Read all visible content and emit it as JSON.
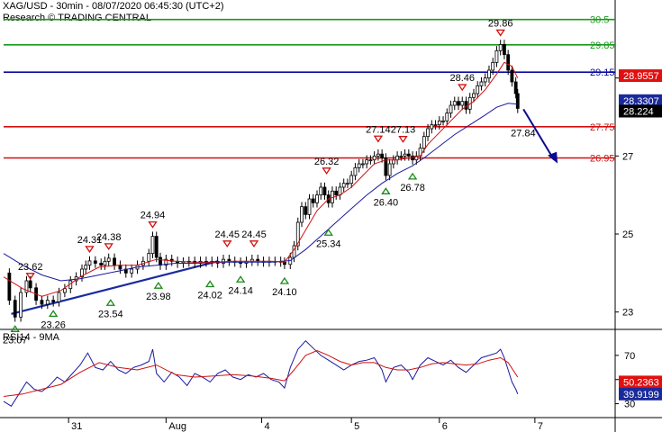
{
  "header": {
    "line1": "XAG/USD - 30min - 08/07/2020 06:45:30 (UTC+2)",
    "line2": "Research © TRADING CENTRAL"
  },
  "colors": {
    "candle": "#000000",
    "ma_fast": "#d01010",
    "ma_slow": "#1a1aa0",
    "trendline": "#1a2aa0",
    "level_green": "#1a9a1a",
    "level_blue": "#0a0aa0",
    "level_red": "#d01010",
    "arrow": "#0a0a90",
    "up_marker": "#1a8a1a",
    "down_marker": "#d01010",
    "rsi_line": "#1a1aa0",
    "rsi_ma": "#d01010"
  },
  "chart_data": {
    "type": "line",
    "title": "XAG/USD - 30min",
    "ylim": [
      22.6,
      31.0
    ],
    "price_ticks": [
      "23",
      "25",
      "27",
      "29"
    ],
    "x_tick_labels": [
      "31",
      "Aug",
      "4",
      "5",
      "6",
      "7"
    ],
    "levels": [
      {
        "value": 30.5,
        "label": "30.5",
        "color": "level_green"
      },
      {
        "value": 29.85,
        "label": "29.85",
        "color": "level_green"
      },
      {
        "value": 29.15,
        "label": "29.15",
        "color": "level_blue"
      },
      {
        "value": 27.75,
        "label": "27.75",
        "color": "level_red"
      },
      {
        "value": 26.95,
        "label": "26.95",
        "color": "level_red"
      }
    ],
    "price_tags": [
      {
        "label": "28.9557",
        "value": 29.06,
        "bg": "#e01010"
      },
      {
        "label": "28.3307",
        "value": 28.42,
        "bg": "#1a2a9a"
      },
      {
        "label": "28.224",
        "value": 28.15,
        "bg": "#000000"
      }
    ],
    "up_markers": [
      {
        "label": "23.07",
        "t": 6,
        "value": 22.87
      },
      {
        "label": "23.26",
        "t": 26,
        "value": 23.26
      },
      {
        "label": "23.54",
        "t": 56,
        "value": 23.54
      },
      {
        "label": "23.98",
        "t": 81,
        "value": 23.98
      },
      {
        "label": "24.02",
        "t": 108,
        "value": 24.02
      },
      {
        "label": "24.14",
        "t": 124,
        "value": 24.14
      },
      {
        "label": "24.10",
        "t": 147,
        "value": 24.1
      },
      {
        "label": "25.34",
        "t": 170,
        "value": 25.34
      },
      {
        "label": "26.40",
        "t": 200,
        "value": 26.4
      },
      {
        "label": "26.78",
        "t": 214,
        "value": 26.78
      }
    ],
    "down_markers": [
      {
        "label": "23.62",
        "t": 14,
        "value": 23.62
      },
      {
        "label": "24.31",
        "t": 45,
        "value": 24.31
      },
      {
        "label": "24.38",
        "t": 55,
        "value": 24.38
      },
      {
        "label": "24.94",
        "t": 78,
        "value": 24.94
      },
      {
        "label": "24.45",
        "t": 117,
        "value": 24.45
      },
      {
        "label": "24.45",
        "t": 131,
        "value": 24.45
      },
      {
        "label": "26.32",
        "t": 169,
        "value": 26.32
      },
      {
        "label": "27.14",
        "t": 196,
        "value": 27.14
      },
      {
        "label": "27.13",
        "t": 209,
        "value": 27.13
      },
      {
        "label": "28.46",
        "t": 240,
        "value": 28.46
      },
      {
        "label": "29.86",
        "t": 260,
        "value": 29.86
      }
    ],
    "price_path": [
      [
        0,
        24.0
      ],
      [
        3,
        23.3
      ],
      [
        6,
        22.87
      ],
      [
        9,
        23.5
      ],
      [
        12,
        23.8
      ],
      [
        14,
        23.62
      ],
      [
        17,
        23.3
      ],
      [
        20,
        23.2
      ],
      [
        23,
        23.3
      ],
      [
        26,
        23.26
      ],
      [
        29,
        23.5
      ],
      [
        32,
        23.6
      ],
      [
        35,
        23.8
      ],
      [
        38,
        23.9
      ],
      [
        41,
        24.1
      ],
      [
        43,
        24.2
      ],
      [
        45,
        24.31
      ],
      [
        48,
        24.25
      ],
      [
        51,
        24.2
      ],
      [
        53,
        24.3
      ],
      [
        55,
        24.38
      ],
      [
        58,
        24.2
      ],
      [
        61,
        24.1
      ],
      [
        64,
        24.0
      ],
      [
        67,
        24.1
      ],
      [
        70,
        24.2
      ],
      [
        73,
        24.3
      ],
      [
        76,
        24.5
      ],
      [
        78,
        24.94
      ],
      [
        80,
        24.4
      ],
      [
        82,
        24.2
      ],
      [
        85,
        24.35
      ],
      [
        88,
        24.3
      ],
      [
        91,
        24.25
      ],
      [
        94,
        24.28
      ],
      [
        97,
        24.3
      ],
      [
        100,
        24.25
      ],
      [
        103,
        24.3
      ],
      [
        106,
        24.28
      ],
      [
        109,
        24.3
      ],
      [
        112,
        24.25
      ],
      [
        115,
        24.35
      ],
      [
        118,
        24.3
      ],
      [
        121,
        24.28
      ],
      [
        124,
        24.25
      ],
      [
        127,
        24.3
      ],
      [
        130,
        24.35
      ],
      [
        133,
        24.3
      ],
      [
        136,
        24.28
      ],
      [
        139,
        24.3
      ],
      [
        142,
        24.3
      ],
      [
        145,
        24.28
      ],
      [
        147,
        24.22
      ],
      [
        150,
        24.4
      ],
      [
        152,
        24.7
      ],
      [
        154,
        25.3
      ],
      [
        156,
        25.7
      ],
      [
        158,
        25.5
      ],
      [
        160,
        25.9
      ],
      [
        162,
        25.8
      ],
      [
        164,
        26.0
      ],
      [
        166,
        26.2
      ],
      [
        168,
        26.0
      ],
      [
        170,
        25.8
      ],
      [
        172,
        26.1
      ],
      [
        174,
        26.0
      ],
      [
        176,
        26.2
      ],
      [
        178,
        26.3
      ],
      [
        180,
        26.3
      ],
      [
        182,
        26.5
      ],
      [
        184,
        26.7
      ],
      [
        186,
        26.8
      ],
      [
        188,
        26.8
      ],
      [
        190,
        26.9
      ],
      [
        192,
        26.9
      ],
      [
        194,
        27.0
      ],
      [
        196,
        27.05
      ],
      [
        198,
        26.95
      ],
      [
        200,
        26.5
      ],
      [
        202,
        26.8
      ],
      [
        204,
        26.9
      ],
      [
        206,
        27.0
      ],
      [
        208,
        27.0
      ],
      [
        210,
        27.05
      ],
      [
        212,
        27.0
      ],
      [
        214,
        26.9
      ],
      [
        216,
        27.0
      ],
      [
        218,
        27.2
      ],
      [
        220,
        27.5
      ],
      [
        222,
        27.7
      ],
      [
        224,
        27.8
      ],
      [
        226,
        27.8
      ],
      [
        228,
        27.9
      ],
      [
        230,
        27.9
      ],
      [
        232,
        28.1
      ],
      [
        234,
        28.3
      ],
      [
        236,
        28.4
      ],
      [
        238,
        28.3
      ],
      [
        240,
        28.4
      ],
      [
        242,
        28.2
      ],
      [
        244,
        28.5
      ],
      [
        246,
        28.6
      ],
      [
        248,
        28.8
      ],
      [
        250,
        28.9
      ],
      [
        252,
        29.0
      ],
      [
        254,
        29.2
      ],
      [
        256,
        29.4
      ],
      [
        258,
        29.7
      ],
      [
        260,
        29.86
      ],
      [
        262,
        29.6
      ],
      [
        264,
        29.2
      ],
      [
        266,
        28.9
      ],
      [
        268,
        28.6
      ],
      [
        269,
        28.22
      ]
    ],
    "ma_fast_path": [
      [
        0,
        23.9
      ],
      [
        10,
        23.6
      ],
      [
        20,
        23.4
      ],
      [
        30,
        23.55
      ],
      [
        40,
        23.9
      ],
      [
        50,
        24.15
      ],
      [
        60,
        24.2
      ],
      [
        70,
        24.2
      ],
      [
        80,
        24.35
      ],
      [
        90,
        24.3
      ],
      [
        100,
        24.28
      ],
      [
        110,
        24.28
      ],
      [
        120,
        24.3
      ],
      [
        130,
        24.3
      ],
      [
        140,
        24.3
      ],
      [
        147,
        24.28
      ],
      [
        152,
        24.6
      ],
      [
        158,
        25.1
      ],
      [
        164,
        25.6
      ],
      [
        170,
        25.9
      ],
      [
        176,
        26.0
      ],
      [
        182,
        26.2
      ],
      [
        188,
        26.5
      ],
      [
        194,
        26.8
      ],
      [
        200,
        26.9
      ],
      [
        206,
        26.9
      ],
      [
        212,
        26.95
      ],
      [
        218,
        27.0
      ],
      [
        222,
        27.3
      ],
      [
        228,
        27.6
      ],
      [
        234,
        27.9
      ],
      [
        240,
        28.2
      ],
      [
        246,
        28.4
      ],
      [
        252,
        28.7
      ],
      [
        258,
        29.1
      ],
      [
        262,
        29.4
      ],
      [
        266,
        29.3
      ],
      [
        269,
        29.0
      ]
    ],
    "ma_slow_path": [
      [
        0,
        24.5
      ],
      [
        10,
        24.2
      ],
      [
        20,
        23.95
      ],
      [
        30,
        23.8
      ],
      [
        40,
        23.85
      ],
      [
        50,
        23.95
      ],
      [
        60,
        24.05
      ],
      [
        70,
        24.15
      ],
      [
        80,
        24.2
      ],
      [
        90,
        24.25
      ],
      [
        100,
        24.25
      ],
      [
        110,
        24.27
      ],
      [
        120,
        24.28
      ],
      [
        130,
        24.28
      ],
      [
        140,
        24.28
      ],
      [
        150,
        24.32
      ],
      [
        158,
        24.6
      ],
      [
        166,
        24.95
      ],
      [
        174,
        25.3
      ],
      [
        182,
        25.65
      ],
      [
        190,
        26.0
      ],
      [
        198,
        26.3
      ],
      [
        206,
        26.55
      ],
      [
        214,
        26.75
      ],
      [
        220,
        26.95
      ],
      [
        228,
        27.25
      ],
      [
        236,
        27.55
      ],
      [
        244,
        27.8
      ],
      [
        252,
        28.05
      ],
      [
        258,
        28.25
      ],
      [
        264,
        28.35
      ],
      [
        269,
        28.33
      ]
    ],
    "trendline": {
      "start": [
        4,
        22.95
      ],
      "end": [
        112,
        24.3
      ]
    },
    "forecast": {
      "label": "27.84",
      "start": [
        272,
        28.2
      ],
      "end": [
        288,
        26.9
      ]
    },
    "rsi": {
      "title": "RSI14 - 9MA",
      "ylim": [
        20,
        90
      ],
      "ticks": [
        "70",
        "50",
        "30"
      ],
      "tags": [
        {
          "label": "50.2363",
          "value": 48,
          "bg": "#e01010"
        },
        {
          "label": "39.9199",
          "value": 38,
          "bg": "#1a2a9a"
        }
      ],
      "line": [
        [
          0,
          32
        ],
        [
          4,
          28
        ],
        [
          8,
          38
        ],
        [
          12,
          48
        ],
        [
          16,
          42
        ],
        [
          20,
          40
        ],
        [
          24,
          45
        ],
        [
          28,
          52
        ],
        [
          32,
          48
        ],
        [
          36,
          55
        ],
        [
          40,
          62
        ],
        [
          44,
          72
        ],
        [
          48,
          60
        ],
        [
          52,
          58
        ],
        [
          56,
          65
        ],
        [
          60,
          58
        ],
        [
          64,
          55
        ],
        [
          68,
          60
        ],
        [
          72,
          62
        ],
        [
          76,
          65
        ],
        [
          78,
          75
        ],
        [
          80,
          55
        ],
        [
          84,
          48
        ],
        [
          88,
          56
        ],
        [
          92,
          52
        ],
        [
          96,
          45
        ],
        [
          100,
          55
        ],
        [
          104,
          52
        ],
        [
          108,
          48
        ],
        [
          112,
          55
        ],
        [
          116,
          58
        ],
        [
          120,
          52
        ],
        [
          124,
          50
        ],
        [
          128,
          54
        ],
        [
          132,
          52
        ],
        [
          136,
          55
        ],
        [
          140,
          50
        ],
        [
          144,
          48
        ],
        [
          147,
          43
        ],
        [
          150,
          60
        ],
        [
          154,
          75
        ],
        [
          158,
          82
        ],
        [
          162,
          76
        ],
        [
          166,
          70
        ],
        [
          170,
          66
        ],
        [
          174,
          62
        ],
        [
          178,
          58
        ],
        [
          182,
          62
        ],
        [
          186,
          65
        ],
        [
          190,
          66
        ],
        [
          194,
          68
        ],
        [
          198,
          58
        ],
        [
          200,
          48
        ],
        [
          204,
          60
        ],
        [
          208,
          62
        ],
        [
          212,
          56
        ],
        [
          214,
          50
        ],
        [
          218,
          62
        ],
        [
          222,
          68
        ],
        [
          226,
          65
        ],
        [
          230,
          62
        ],
        [
          234,
          66
        ],
        [
          238,
          60
        ],
        [
          242,
          56
        ],
        [
          246,
          62
        ],
        [
          250,
          68
        ],
        [
          254,
          70
        ],
        [
          258,
          72
        ],
        [
          260,
          75
        ],
        [
          262,
          68
        ],
        [
          264,
          58
        ],
        [
          266,
          48
        ],
        [
          268,
          42
        ],
        [
          269,
          38
        ]
      ],
      "ma": [
        [
          0,
          36
        ],
        [
          10,
          38
        ],
        [
          20,
          42
        ],
        [
          30,
          46
        ],
        [
          40,
          56
        ],
        [
          50,
          64
        ],
        [
          60,
          60
        ],
        [
          70,
          58
        ],
        [
          80,
          62
        ],
        [
          90,
          54
        ],
        [
          100,
          52
        ],
        [
          110,
          53
        ],
        [
          120,
          54
        ],
        [
          130,
          53
        ],
        [
          140,
          51
        ],
        [
          147,
          49
        ],
        [
          152,
          58
        ],
        [
          158,
          70
        ],
        [
          164,
          74
        ],
        [
          170,
          70
        ],
        [
          176,
          65
        ],
        [
          182,
          62
        ],
        [
          188,
          64
        ],
        [
          194,
          64
        ],
        [
          200,
          60
        ],
        [
          206,
          58
        ],
        [
          212,
          58
        ],
        [
          218,
          60
        ],
        [
          224,
          63
        ],
        [
          230,
          64
        ],
        [
          236,
          63
        ],
        [
          242,
          62
        ],
        [
          248,
          63
        ],
        [
          254,
          66
        ],
        [
          260,
          68
        ],
        [
          264,
          64
        ],
        [
          269,
          52
        ]
      ]
    }
  }
}
